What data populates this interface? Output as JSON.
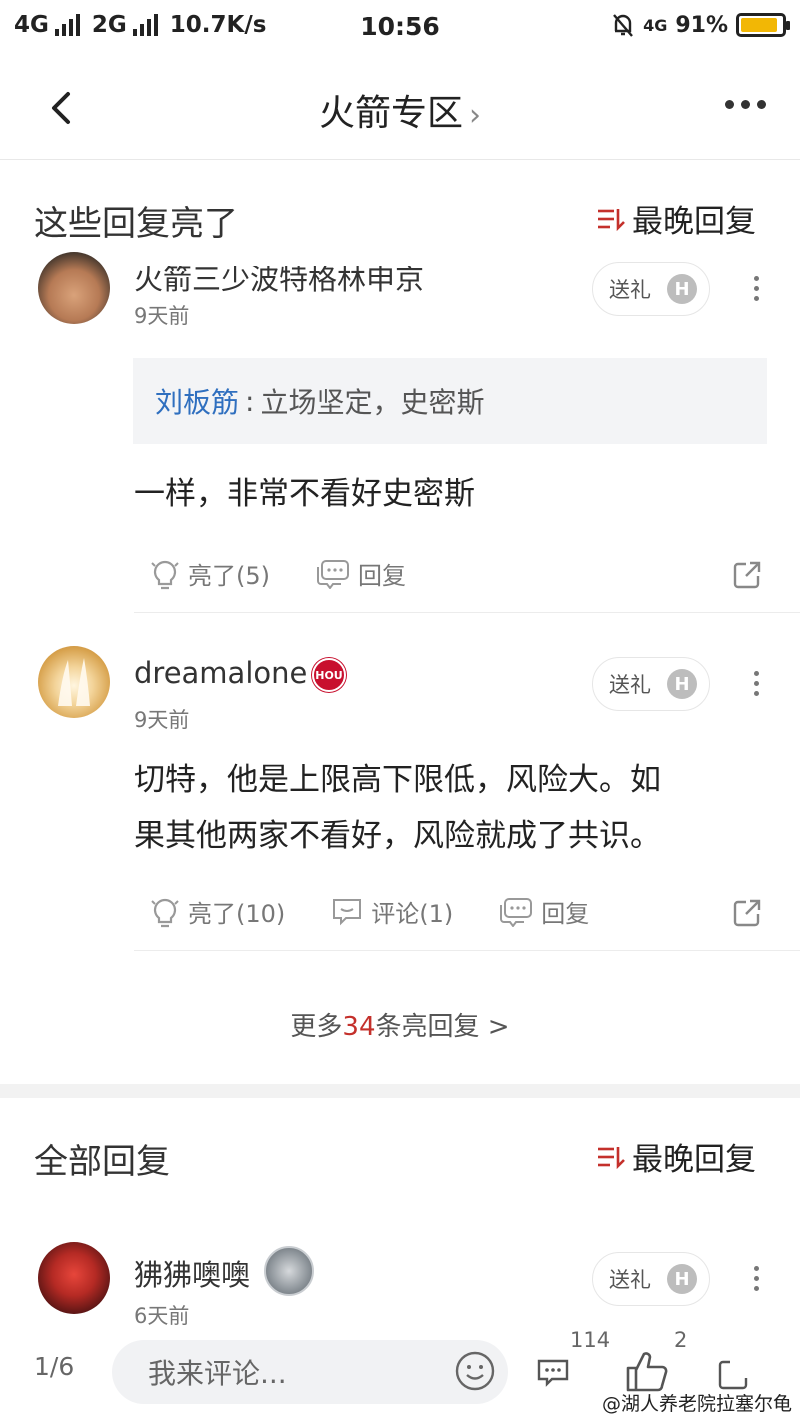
{
  "status_bar": {
    "net1": "4G",
    "net2": "2G",
    "speed": "10.7K/s",
    "time": "10:56",
    "net3": "4G",
    "battery_text": "91%",
    "battery_level": 0.91,
    "battery_color": "#f2b705"
  },
  "nav": {
    "title": "火箭专区",
    "title_chevron": "›",
    "back_icon": "chevron-left-icon",
    "more_icon": "more-horizontal-icon"
  },
  "hot_section": {
    "title": "这些回复亮了",
    "sort_label": "最晚回复"
  },
  "posts": [
    {
      "name": "火箭三少波特格林申京",
      "time": "9天前",
      "gift_label": "送礼",
      "gift_badge": "H",
      "quote_name": "刘板筋",
      "quote_sep": ":",
      "quote_text": "立场坚定，史密斯",
      "body": "一样，非常不看好史密斯",
      "like_label": "亮了(5)",
      "reply_label": "回复"
    },
    {
      "name": "dreamalone",
      "team_badge": "HOU",
      "time": "9天前",
      "gift_label": "送礼",
      "gift_badge": "H",
      "body_line1": "切特，他是上限高下限低，风险大。如",
      "body_line2": "果其他两家不看好，风险就成了共识。",
      "like_label": "亮了(10)",
      "comment_label": "评论(1)",
      "reply_label": "回复"
    }
  ],
  "more_replies": {
    "prefix": "更多",
    "count": "34",
    "suffix": "条亮回复 >"
  },
  "all_section": {
    "title": "全部回复",
    "sort_label": "最晚回复"
  },
  "reply3": {
    "name": "狒狒噢噢",
    "time": "6天前",
    "gift_label": "送礼",
    "gift_badge": "H"
  },
  "bottom": {
    "pager": "1/6",
    "input_placeholder": "我来评论...",
    "comment_count": "114",
    "like_count": "2",
    "watermark": "@湖人养老院拉塞尔龟"
  },
  "colors": {
    "accent_red": "#c4302b",
    "link_blue": "#2f6fbf"
  }
}
